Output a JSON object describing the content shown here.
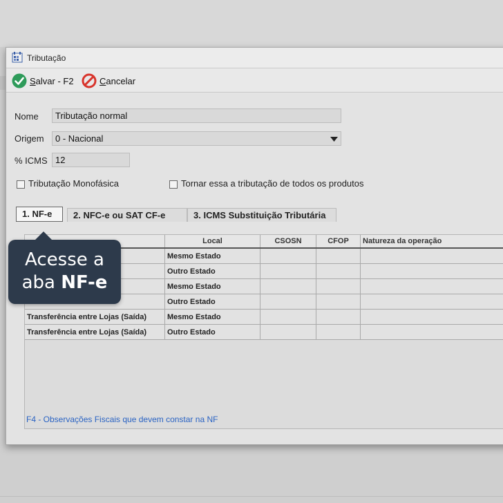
{
  "window": {
    "title": "Tributação"
  },
  "toolbar": {
    "save": "alvar - F2",
    "save_key": "S",
    "cancel": "ancelar",
    "cancel_key": "C"
  },
  "form": {
    "nome_label": "Nome",
    "nome_value": "Tributação normal",
    "origem_label": "Origem",
    "origem_value": "0 - Nacional",
    "icms_label": "% ICMS",
    "icms_value": "12",
    "chk_monofasica": "Tributação Monofásica",
    "chk_todos": "Tornar essa a tributação de todos os produtos"
  },
  "tabs": [
    "1. NF-e",
    "2. NFC-e ou SAT CF-e",
    "3. ICMS Substituição Tributária"
  ],
  "grid": {
    "columns": [
      "",
      "Local",
      "CSOSN",
      "CFOP",
      "Natureza da operação"
    ],
    "rows": [
      {
        "op": "",
        "local": "Mesmo Estado",
        "csosn": "",
        "cfop": "",
        "natureza": ""
      },
      {
        "op": "",
        "local": "Outro Estado",
        "csosn": "",
        "cfop": "",
        "natureza": ""
      },
      {
        "op": "",
        "local": "Mesmo Estado",
        "csosn": "",
        "cfop": "",
        "natureza": ""
      },
      {
        "op": "",
        "local": "Outro Estado",
        "csosn": "",
        "cfop": "",
        "natureza": ""
      },
      {
        "op": "Transferência entre Lojas (Saída)",
        "local": "Mesmo Estado",
        "csosn": "",
        "cfop": "",
        "natureza": ""
      },
      {
        "op": "Transferência entre Lojas (Saída)",
        "local": "Outro Estado",
        "csosn": "",
        "cfop": "",
        "natureza": ""
      }
    ]
  },
  "footer_note": "F4 - Observações Fiscais que devem constar na NF",
  "callout": {
    "line1": "Acesse a",
    "line2_prefix": "aba ",
    "line2_bold": "NF-e"
  },
  "colors": {
    "accent_blue": "#2a63c3",
    "callout_bg": "#2d3a4b",
    "save_green": "#2e9b5a",
    "cancel_red": "#d8342c"
  },
  "icons": {
    "app": "tax-form-icon",
    "save": "check-circle-icon",
    "cancel": "prohibited-icon",
    "dropdown": "triangle-down-icon"
  }
}
